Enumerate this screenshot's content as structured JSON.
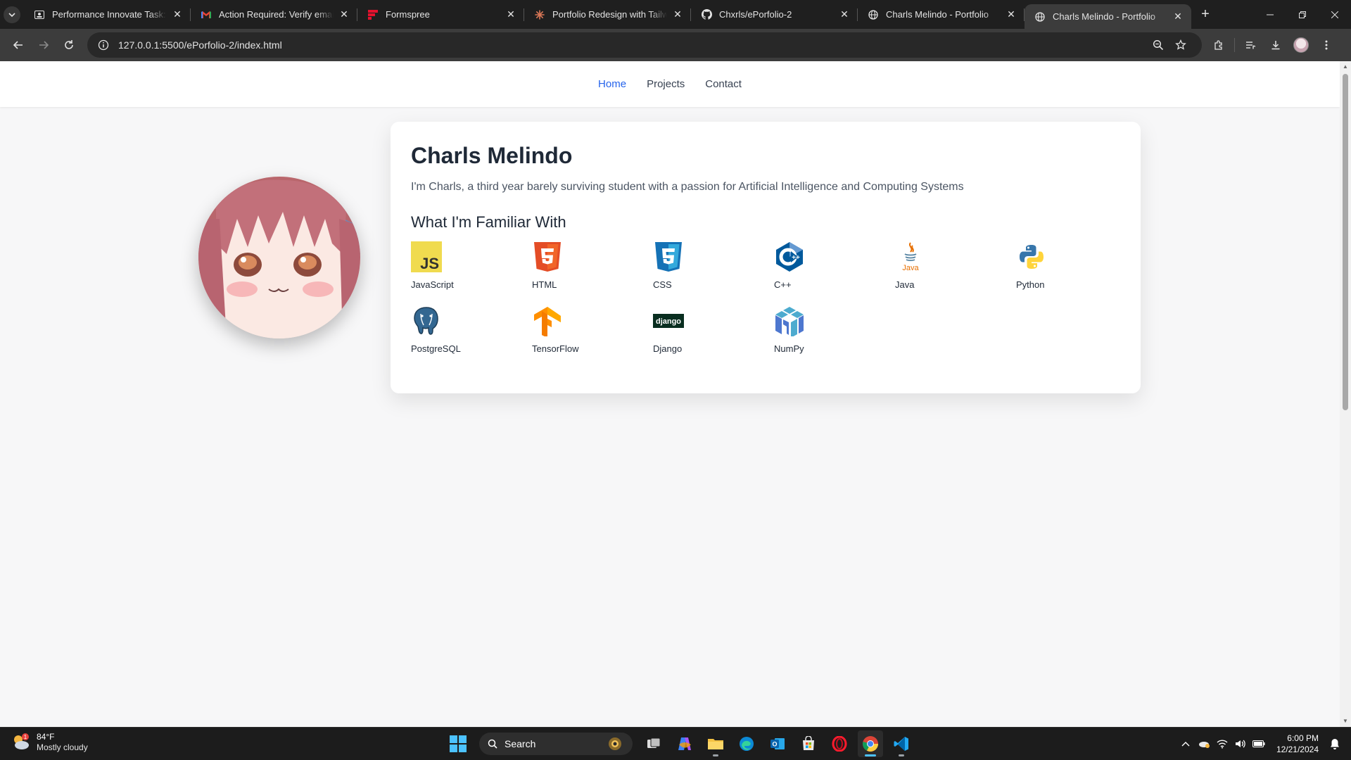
{
  "browser": {
    "tabs": [
      {
        "title": "Performance Innovate Task: Epo",
        "icon": "classroom-icon"
      },
      {
        "title": "Action Required: Verify email lin",
        "icon": "gmail-icon"
      },
      {
        "title": "Formspree",
        "icon": "formspree-icon"
      },
      {
        "title": "Portfolio Redesign with Tailwind",
        "icon": "claude-icon"
      },
      {
        "title": "Chxrls/ePorfolio-2",
        "icon": "github-icon"
      },
      {
        "title": "Charls Melindo - Portfolio",
        "icon": "globe-icon"
      },
      {
        "title": "Charls Melindo - Portfolio",
        "icon": "globe-icon",
        "active": true
      }
    ],
    "url": "127.0.0.1:5500/ePorfolio-2/index.html"
  },
  "site": {
    "nav": [
      "Home",
      "Projects",
      "Contact"
    ],
    "nav_active": "Home",
    "name": "Charls Melindo",
    "bio": "I'm Charls, a third year barely surviving student with a passion for Artificial Intelligence and Computing Systems",
    "skills_heading": "What I'm Familiar With",
    "skills": [
      {
        "label": "JavaScript",
        "icon": "javascript-icon"
      },
      {
        "label": "HTML",
        "icon": "html5-icon"
      },
      {
        "label": "CSS",
        "icon": "css3-icon"
      },
      {
        "label": "C++",
        "icon": "cpp-icon"
      },
      {
        "label": "Java",
        "icon": "java-icon"
      },
      {
        "label": "Python",
        "icon": "python-icon"
      },
      {
        "label": "PostgreSQL",
        "icon": "postgresql-icon"
      },
      {
        "label": "TensorFlow",
        "icon": "tensorflow-icon"
      },
      {
        "label": "Django",
        "icon": "django-icon"
      },
      {
        "label": "NumPy",
        "icon": "numpy-icon"
      }
    ],
    "colors": {
      "accent": "#2563eb",
      "heading": "#1f2937",
      "text": "#4b5563"
    }
  },
  "taskbar": {
    "weather": {
      "temp": "84°F",
      "condition": "Mostly cloudy",
      "badge": "1"
    },
    "search_label": "Search",
    "time": "6:00 PM",
    "date": "12/21/2024"
  }
}
